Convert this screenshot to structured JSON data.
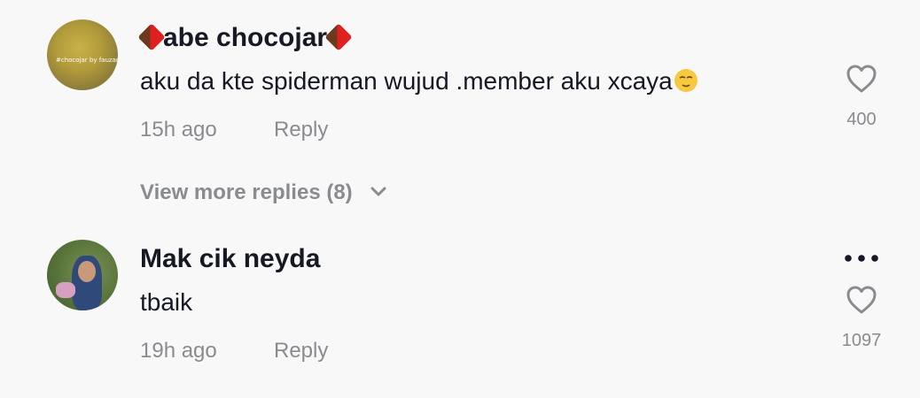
{
  "comments": [
    {
      "username": "abe chocojar",
      "avatar_tag": "#chocojar by fauzan",
      "text": "aku da kte spiderman wujud .member aku xcaya",
      "time": "15h ago",
      "reply_label": "Reply",
      "likes": "400",
      "view_more": "View more replies (8)"
    },
    {
      "username": "Mak cik neyda",
      "text": "tbaik",
      "time": "19h ago",
      "reply_label": "Reply",
      "likes": "1097"
    }
  ],
  "icons": {
    "username_decoration": "chocolate-bar-icon",
    "emoji": "relieved-face-emoji",
    "like": "heart-outline-icon",
    "expand": "chevron-down-icon",
    "more": "more-dots-icon"
  },
  "colors": {
    "background": "#f8f8f8",
    "primary_text": "#161823",
    "secondary_text": "#8a8b91"
  }
}
